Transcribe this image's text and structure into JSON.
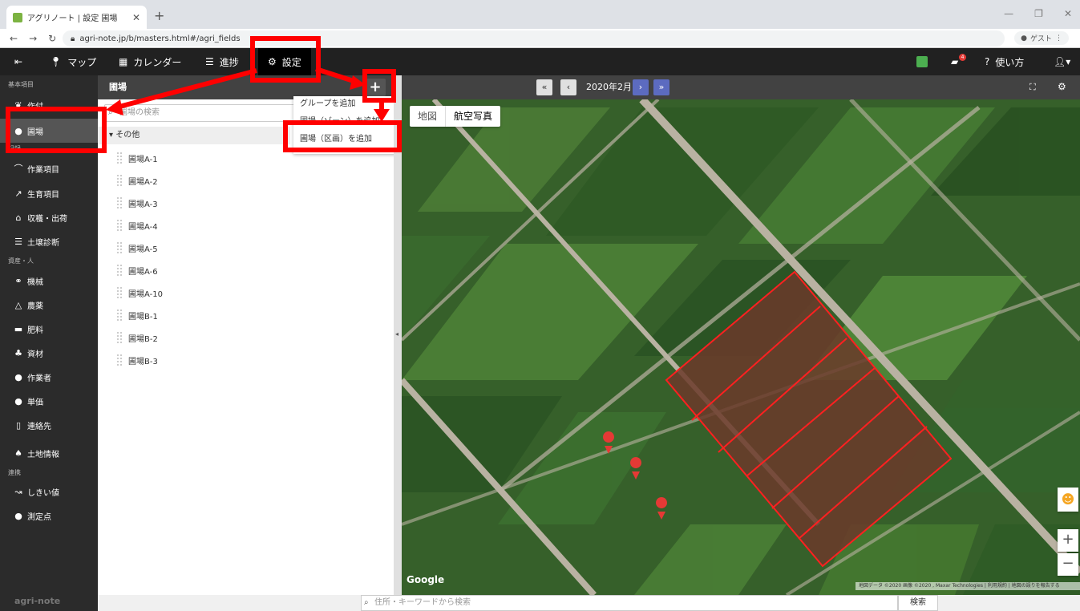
{
  "browser": {
    "tab_title": "アグリノート | 設定 圃場",
    "url": "agri-note.jp/b/masters.html#/agri_fields",
    "profile_label": "ゲスト"
  },
  "appbar": {
    "map_label": "マップ",
    "calendar_label": "カレンダー",
    "progress_label": "進捗",
    "settings_label": "設定",
    "help_label": "使い方",
    "notification_count": "4"
  },
  "sidebar": {
    "section_basic": "基本項目",
    "section_records": "記録",
    "section_assets": "資産・人",
    "section_links": "連携",
    "items": [
      {
        "label": "作付"
      },
      {
        "label": "圃場"
      },
      {
        "label": "作業項目"
      },
      {
        "label": "生育項目"
      },
      {
        "label": "収穫・出荷"
      },
      {
        "label": "土壌診断"
      },
      {
        "label": "機械"
      },
      {
        "label": "農薬"
      },
      {
        "label": "肥料"
      },
      {
        "label": "資材"
      },
      {
        "label": "作業者"
      },
      {
        "label": "単価"
      },
      {
        "label": "連絡先"
      },
      {
        "label": "土地情報"
      },
      {
        "label": "しきい値"
      },
      {
        "label": "測定点"
      }
    ],
    "footer_logo": "agri-note"
  },
  "list_panel": {
    "title": "圃場",
    "search_placeholder": "圃場の検索",
    "group_name": "その他",
    "fields": [
      "圃場A-1",
      "圃場A-2",
      "圃場A-3",
      "圃場A-4",
      "圃場A-5",
      "圃場A-6",
      "圃場A-10",
      "圃場B-1",
      "圃場B-2",
      "圃場B-3"
    ],
    "menu": {
      "add_group": "グループを追加",
      "add_field": "圃場（ゾーン）を追加",
      "add_section": "圃場（区画）を追加"
    }
  },
  "map": {
    "month": "2020年2月",
    "type_map": "地図",
    "type_satellite": "航空写真",
    "google_label": "Google",
    "attribution": "地図データ ©2020 画像 ©2020 , Maxar Technologies | 利用規約 | 地図の誤りを報告する"
  },
  "bottom": {
    "search_placeholder": "住所・キーワードから検索",
    "search_button": "検索"
  },
  "colors": {
    "annotation": "#ff0000",
    "field_outline": "#ff2020",
    "crop_green": "#3e6b2c"
  }
}
